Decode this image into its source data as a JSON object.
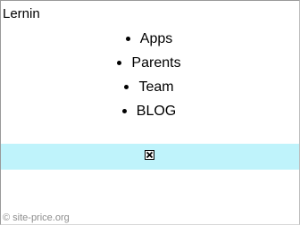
{
  "header": {
    "logo_text": "Lernin"
  },
  "nav": {
    "items": [
      {
        "label": "Apps"
      },
      {
        "label": "Parents"
      },
      {
        "label": "Team"
      },
      {
        "label": "BLOG"
      }
    ]
  },
  "banner": {
    "background_color": "#bff3fb",
    "close_icon": "close-icon"
  },
  "footer": {
    "watermark": "© site-price.org"
  }
}
